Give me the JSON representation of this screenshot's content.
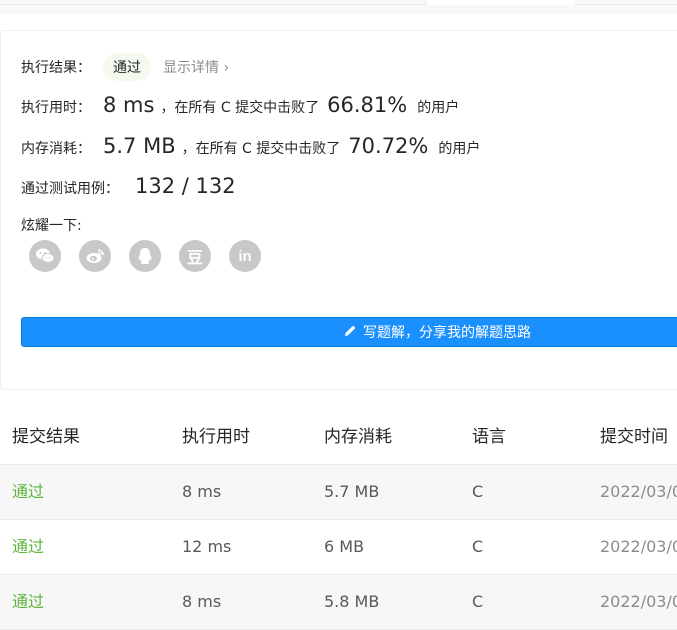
{
  "result": {
    "exec_label": "执行结果：",
    "status": "通过",
    "detail_link": "显示详情 ›",
    "runtime_label": "执行用时：",
    "runtime_value": "8 ms",
    "runtime_text": "，在所有 C 提交中击败了",
    "runtime_pct": "66.81%",
    "runtime_suffix": "的用户",
    "memory_label": "内存消耗：",
    "memory_value": "5.7 MB",
    "memory_text": "，在所有 C 提交中击败了",
    "memory_pct": "70.72%",
    "memory_suffix": "的用户",
    "tests_label": "通过测试用例：",
    "tests_value": "132 / 132",
    "share_label": "炫耀一下:",
    "share_icons": [
      "wechat-icon",
      "weibo-icon",
      "qq-icon",
      "douban-icon",
      "linkedin-icon"
    ],
    "douban_glyph": "豆",
    "linkedin_glyph": "in",
    "write_button": "写题解，分享我的解题思路"
  },
  "table": {
    "headers": [
      "提交结果",
      "执行用时",
      "内存消耗",
      "语言",
      "提交时间"
    ],
    "rows": [
      {
        "status": "通过",
        "runtime": "8 ms",
        "memory": "5.7 MB",
        "lang": "C",
        "time": "2022/03/0"
      },
      {
        "status": "通过",
        "runtime": "12 ms",
        "memory": "6 MB",
        "lang": "C",
        "time": "2022/03/0"
      },
      {
        "status": "通过",
        "runtime": "8 ms",
        "memory": "5.8 MB",
        "lang": "C",
        "time": "2022/03/0"
      }
    ]
  },
  "colors": {
    "accent": "#1a90ff",
    "success": "#5cb63d",
    "badge_bg": "#f4faf0",
    "share_grey": "#c8c8c8"
  }
}
